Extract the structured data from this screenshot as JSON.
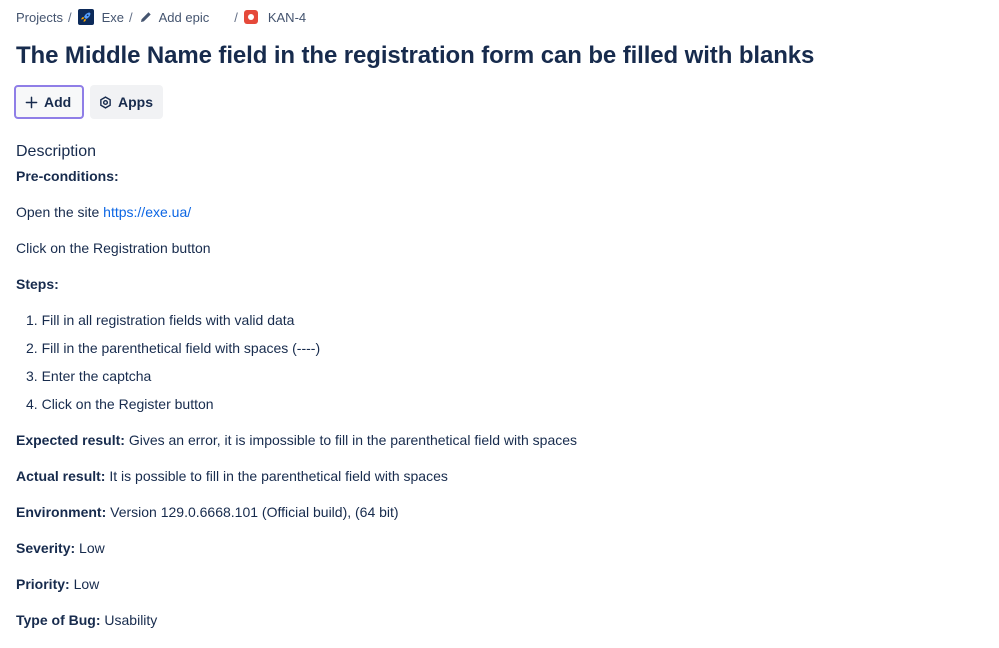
{
  "breadcrumb": {
    "projects": "Projects",
    "project": "Exe",
    "add_epic": "Add epic",
    "issue_key": "KAN-4",
    "separator": "/"
  },
  "issue": {
    "title": "The Middle Name field in the registration form can be filled with blanks"
  },
  "actions": {
    "add_label": "Add",
    "apps_label": "Apps"
  },
  "description": {
    "heading": "Description",
    "preconditions_label": "Pre-conditions:",
    "open_site_text": "Open the site ",
    "site_link": "https://exe.ua/",
    "click_registration": "Click on the Registration button",
    "steps_label": "Steps:",
    "steps": [
      "Fill in all registration fields with valid data",
      "Fill in the parenthetical field with spaces (----)",
      "Enter the captcha",
      "Click on the Register button"
    ],
    "expected_label": "Expected result:",
    "expected_value": " Gives an error, it is impossible to fill in the parenthetical field with spaces",
    "actual_label": "Actual result:",
    "actual_value": " It is possible to fill in the parenthetical field with spaces",
    "environment_label": "Environment:",
    "environment_value": " Version 129.0.6668.101 (Official build), (64 bit)",
    "severity_label": "Severity:",
    "severity_value": " Low",
    "priority_label": "Priority:",
    "priority_value": " Low",
    "bug_type_label": "Type of Bug:",
    "bug_type_value": " Usability"
  },
  "colors": {
    "text": "#172b4d",
    "link": "#0c66e4",
    "add_button_border": "#8f7ee7",
    "bug_icon": "#e5493a"
  },
  "icons": {
    "project": "rocket-icon",
    "add_epic": "pencil-icon",
    "issue_type": "bug-icon",
    "add": "plus-icon",
    "apps": "apps-icon"
  }
}
